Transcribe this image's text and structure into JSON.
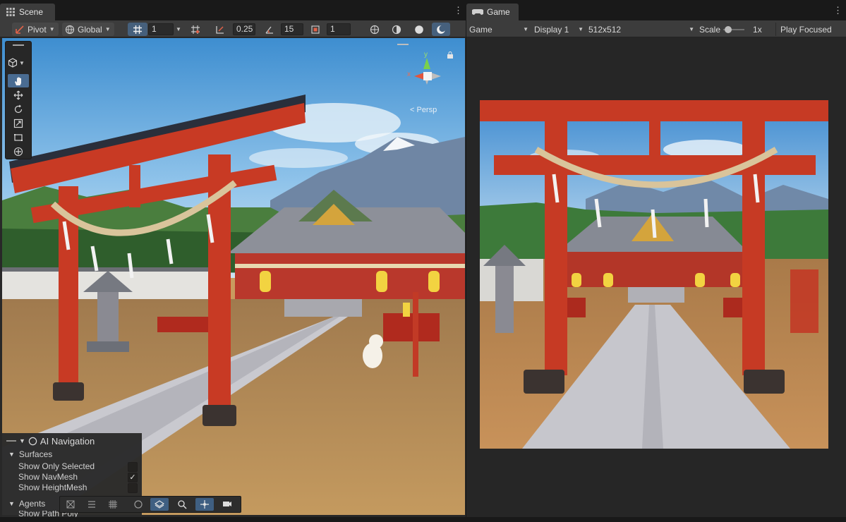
{
  "scene": {
    "tab_label": "Scene",
    "pivot_label": "Pivot",
    "global_label": "Global",
    "grid_value": "1",
    "snap_increment": "0.25",
    "angle_snap": "15",
    "scale_snap": "1",
    "gizmo": {
      "y_axis": "y",
      "x_axis": "x",
      "projection_label": "< Persp"
    }
  },
  "ai_navigation": {
    "title": "AI Navigation",
    "surfaces_label": "Surfaces",
    "options": [
      {
        "label": "Show Only Selected",
        "checked": false
      },
      {
        "label": "Show NavMesh",
        "checked": true
      },
      {
        "label": "Show HeightMesh",
        "checked": false
      }
    ],
    "agents_label": "Agents",
    "partial_row_label": "Show Path Poly"
  },
  "game": {
    "tab_label": "Game",
    "mode_dropdown": "Game",
    "display_dropdown": "Display 1",
    "resolution_dropdown": "512x512",
    "scale_label": "Scale",
    "scale_value": "1x",
    "play_focused": "Play Focused"
  },
  "icons": {
    "tool_palette": [
      "hand-icon",
      "move-icon",
      "rotate-icon",
      "scale-icon",
      "rect-icon",
      "transform-icon"
    ],
    "accent_color": "#46607c",
    "shrine_red": "#c83a24"
  }
}
